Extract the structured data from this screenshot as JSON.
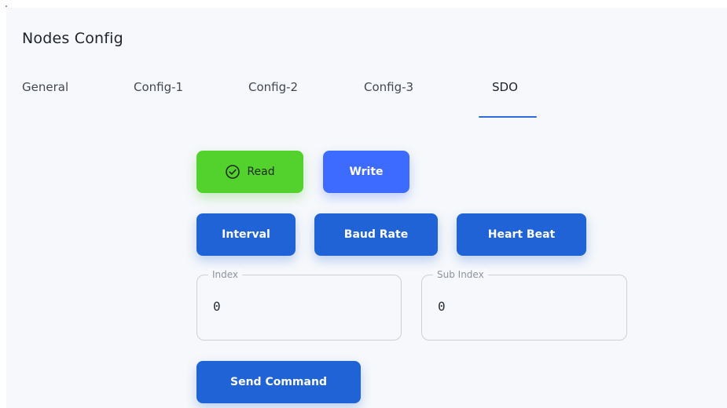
{
  "page": {
    "title": "Nodes Config"
  },
  "tabs": [
    {
      "label": "General"
    },
    {
      "label": "Config-1"
    },
    {
      "label": "Config-2"
    },
    {
      "label": "Config-3"
    },
    {
      "label": "SDO",
      "active": true
    }
  ],
  "actions": {
    "read_label": "Read",
    "write_label": "Write"
  },
  "commands": {
    "interval_label": "Interval",
    "baud_rate_label": "Baud Rate",
    "heart_beat_label": "Heart Beat"
  },
  "fields": {
    "index": {
      "label": "Index",
      "value": "0"
    },
    "sub_index": {
      "label": "Sub Index",
      "value": "0"
    }
  },
  "send_command_label": "Send Command",
  "colors": {
    "read": "#53d12d",
    "write": "#3d6bff",
    "command": "#1f63d6",
    "tab_underline": "#2e6ae0"
  },
  "icons": {
    "read": "check-circle-icon"
  }
}
